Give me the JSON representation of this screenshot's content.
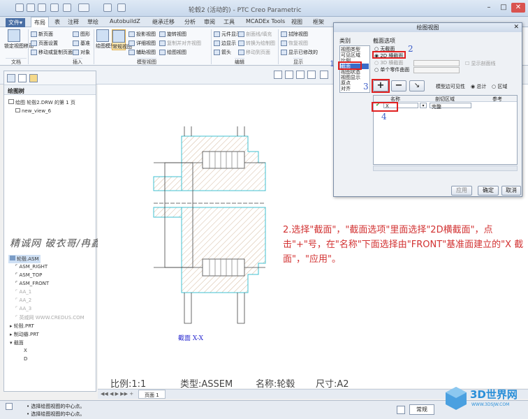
{
  "window": {
    "title": "轮毂2 (活动的) - PTC Creo Parametric"
  },
  "menu": {
    "file": "文件▾"
  },
  "tabs": [
    "布局",
    "表",
    "注释",
    "草绘",
    "AutobuildZ",
    "继承迁移",
    "分析",
    "审阅",
    "工具",
    "MCADEx Tools",
    "视图",
    "框架"
  ],
  "ribbon": {
    "doc_group": {
      "label": "文档",
      "big_button": "锁定视图移动"
    },
    "insert_group": {
      "label": "插入",
      "items": [
        "新页面",
        "页面设置",
        "移动或复制页面"
      ]
    },
    "model_group": {
      "label": "模型视图",
      "big1": "绘图模型",
      "big2": "常规视图",
      "items": [
        "图形",
        "基准",
        "对象",
        "投影视图",
        "详细视图",
        "辅助视图",
        "旋转视图",
        "复制并对齐视图",
        "绘图视图"
      ]
    },
    "edit_group": {
      "label": "编辑",
      "items": [
        "元件显示",
        "边显示",
        "箭头",
        "剖面线/填充",
        "转换为绘制图",
        "移动到页面"
      ]
    },
    "display_group": {
      "label": "显示",
      "items": [
        "拭除视图",
        "恢复视图",
        "显示已修改的"
      ]
    }
  },
  "tree": {
    "header": "绘图树",
    "items": [
      "绘图 轮毂2.DRW 的第 1 页",
      "new_view_6"
    ],
    "model_items": [
      "轮毂.ASM",
      "ASM_RIGHT",
      "ASM_TOP",
      "ASM_FRONT",
      "AA_1",
      "AA_2",
      "AA_3",
      "英威网 WWW.CREDUS.COM",
      "轮毂.PRT",
      "制动瓣.PRT",
      "截面",
      "X",
      "D"
    ]
  },
  "watermark": "精诚网 破衣哥/冉鑫",
  "drawing": {
    "section_label": "截面 X-X"
  },
  "instruction": "2.选择\"截面\"，\"截面选项\"里面选择\"2D横截面\"，点击\"+\"号，在\"名称\"下面选择由\"FRONT\"基准面建立的\"X 截面\"，\"应用\"。",
  "sheet_info": {
    "scale": "比例:1:1",
    "type": "类型:ASSEM",
    "name": "名称:轮毂",
    "size": "尺寸:A2"
  },
  "page_tab": "页面 1",
  "status": {
    "line1": "选择绘图视图的中心点。",
    "line2": "选择绘图视图的中心点。",
    "filter": "常规"
  },
  "dialog": {
    "title": "绘图视图",
    "category_label": "类别",
    "categories": [
      "视图类型",
      "可见区域",
      "比例",
      "截面",
      "视图状态",
      "视图显示",
      "原点",
      "对齐"
    ],
    "options_label": "截面选项",
    "options": [
      "无截面",
      "2D 横截面",
      "3D 横截面",
      "单个零件曲面"
    ],
    "show_xhatch": "显示剖面线",
    "model_edge_visibility": "模型边可见性",
    "vis_total": "总计",
    "vis_area": "区域",
    "col_name": "名称",
    "col_area": "剖切区域",
    "col_ref": "参考",
    "row_name": "X",
    "row_area": "完整",
    "apply": "应用",
    "ok": "确定",
    "cancel": "取消"
  },
  "annotations": [
    "1",
    "2",
    "3",
    "4"
  ],
  "logo": {
    "name": "3D世界网",
    "url": "WWW.3DSJW.COM"
  }
}
